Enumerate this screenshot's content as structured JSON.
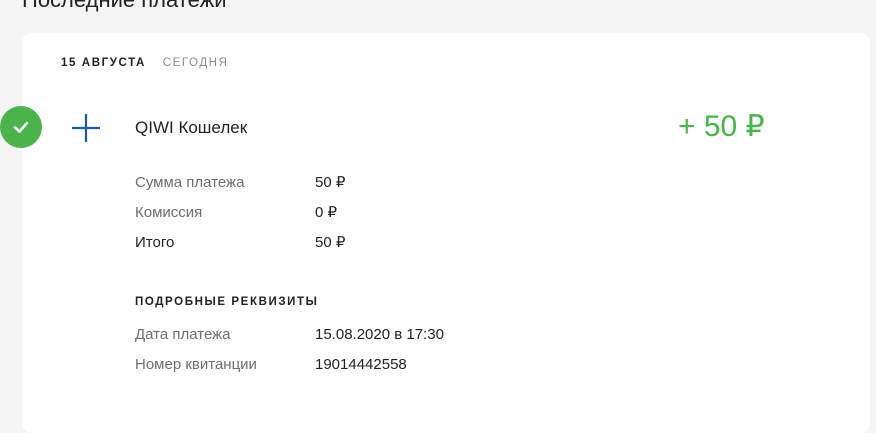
{
  "page": {
    "section_title": "Последние платежи"
  },
  "payment": {
    "date": "15 августа",
    "date_relative": "сегодня",
    "provider": "QIWI Кошелек",
    "amount": "+ 50 ₽",
    "status_icon": "check-icon",
    "provider_icon": "plus-icon"
  },
  "summary": [
    {
      "label": "Сумма платежа",
      "value": "50 ₽"
    },
    {
      "label": "Комиссия",
      "value": "0 ₽"
    },
    {
      "label": "Итого",
      "value": "50 ₽"
    }
  ],
  "details": {
    "title": "Подробные реквизиты",
    "rows": [
      {
        "label": "Дата платежа",
        "value": "15.08.2020 в 17:30"
      },
      {
        "label": "Номер квитанции",
        "value": "19014442558"
      }
    ]
  },
  "colors": {
    "accent_green": "#4bb34b",
    "icon_blue": "#1f5aa6",
    "background": "#f5f5f5",
    "card": "#ffffff"
  }
}
